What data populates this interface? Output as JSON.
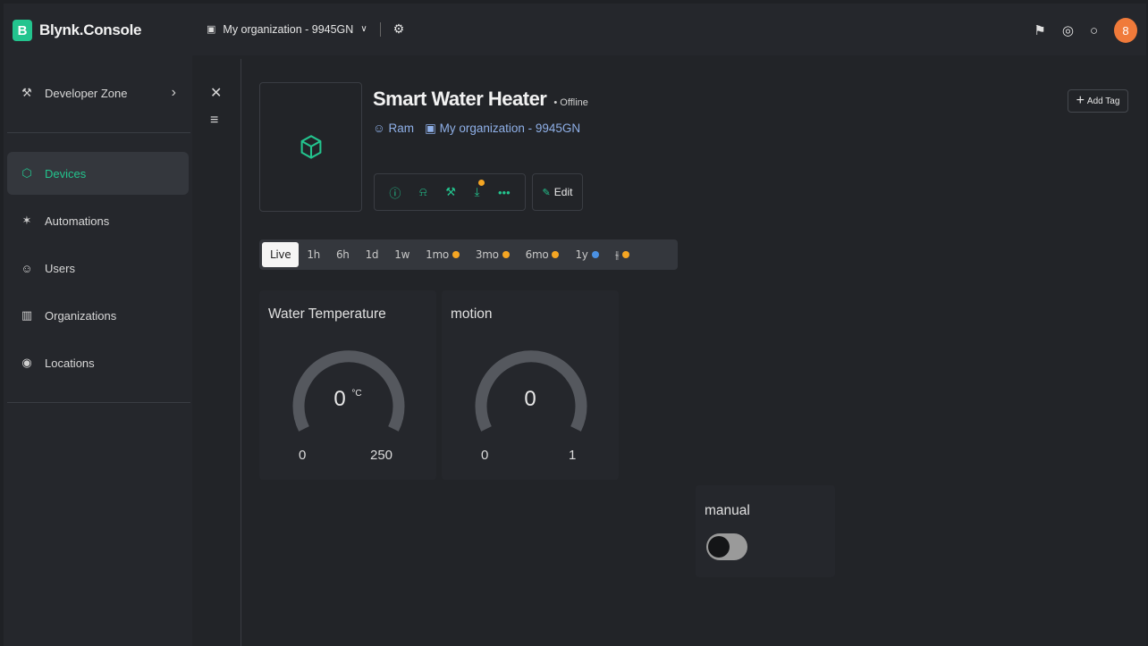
{
  "brand": {
    "logo_letter": "B",
    "name": "Blynk.Console",
    "accent": "#23c48e"
  },
  "sidebar": {
    "items": [
      {
        "label": "Developer Zone",
        "icon": "wrench-icon"
      },
      {
        "label": "Devices",
        "icon": "cube-icon",
        "active": true
      },
      {
        "label": "Automations",
        "icon": "sparkle-icon"
      },
      {
        "label": "Users",
        "icon": "users-icon"
      },
      {
        "label": "Organizations",
        "icon": "building-icon"
      },
      {
        "label": "Locations",
        "icon": "location-pin-icon"
      }
    ]
  },
  "topbar": {
    "org_label": "My organization - 9945GN",
    "avatar_letter": "8"
  },
  "device": {
    "name": "Smart Water Heater",
    "status": "• Offline",
    "owner": "Ram",
    "org": "My organization - 9945GN",
    "edit_label": "Edit",
    "add_tag_label": "Add Tag"
  },
  "time_range": {
    "items": [
      {
        "label": "Live",
        "active": true
      },
      {
        "label": "1h"
      },
      {
        "label": "6h"
      },
      {
        "label": "1d"
      },
      {
        "label": "1w"
      },
      {
        "label": "1mo",
        "dot": "orange"
      },
      {
        "label": "3mo",
        "dot": "orange"
      },
      {
        "label": "6mo",
        "dot": "orange"
      },
      {
        "label": "1y",
        "dot": "blue"
      }
    ]
  },
  "widgets": {
    "water_temp": {
      "title": "Water Temperature",
      "value": "0",
      "unit": "°C",
      "min": "0",
      "max": "250",
      "level": 0
    },
    "motion": {
      "title": "motion",
      "value": "0",
      "min": "0",
      "max": "1",
      "level": 0
    },
    "manual": {
      "title": "manual",
      "state": "off"
    }
  }
}
